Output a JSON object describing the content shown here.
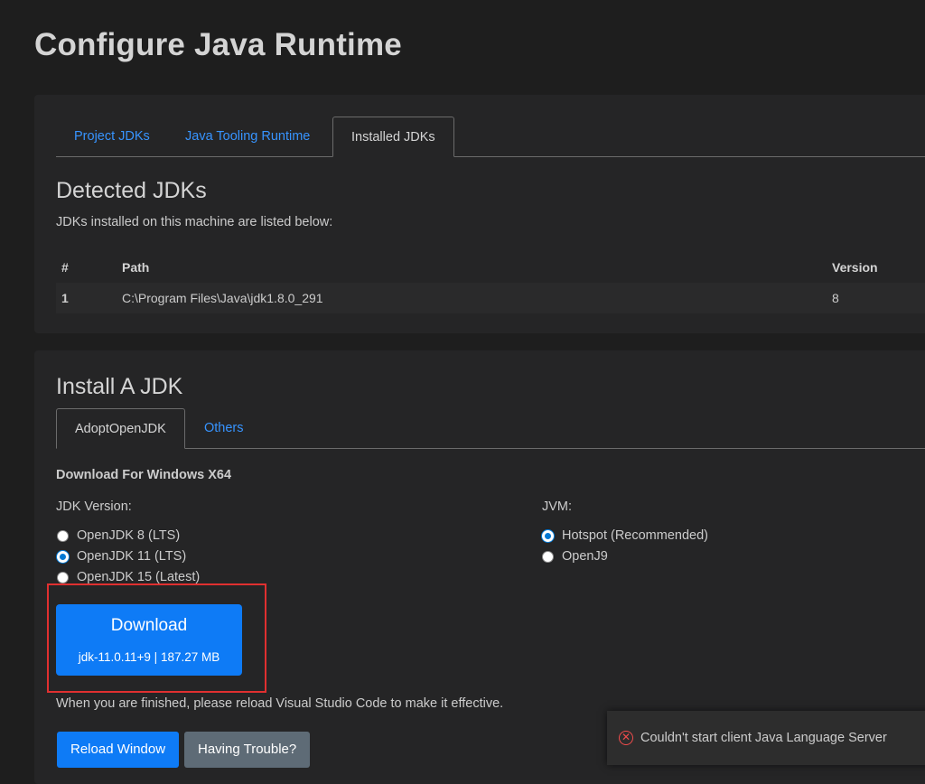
{
  "page": {
    "title": "Configure Java Runtime"
  },
  "panel1": {
    "tabs": [
      "Project JDKs",
      "Java Tooling Runtime",
      "Installed JDKs"
    ],
    "heading": "Detected JDKs",
    "description": "JDKs installed on this machine are listed below:",
    "table": {
      "headers": [
        "#",
        "Path",
        "Version"
      ],
      "rows": [
        {
          "num": "1",
          "path": "C:\\Program Files\\Java\\jdk1.8.0_291",
          "version": "8"
        }
      ]
    }
  },
  "panel2": {
    "heading": "Install A JDK",
    "tabs": [
      "AdoptOpenJDK",
      "Others"
    ],
    "platform_label": "Download For Windows X64",
    "jdk_version_label": "JDK Version:",
    "jdk_versions": [
      "OpenJDK 8 (LTS)",
      "OpenJDK 11 (LTS)",
      "OpenJDK 15 (Latest)"
    ],
    "jdk_selected": "OpenJDK 11 (LTS)",
    "jvm_label": "JVM:",
    "jvm_options": [
      "Hotspot (Recommended)",
      "OpenJ9"
    ],
    "jvm_selected": "Hotspot (Recommended)",
    "download": {
      "label": "Download",
      "sub": "jdk-11.0.11+9 | 187.27 MB"
    },
    "finish_note": "When you are finished, please reload Visual Studio Code to make it effective.",
    "reload_label": "Reload Window",
    "trouble_label": "Having Trouble?"
  },
  "toast": {
    "message": "Couldn't start client Java Language Server",
    "icon": "error-circle-icon"
  },
  "colors": {
    "accent": "#0e7bf6",
    "link": "#3794ff",
    "error": "#f14c4c",
    "highlight": "#e03030"
  }
}
